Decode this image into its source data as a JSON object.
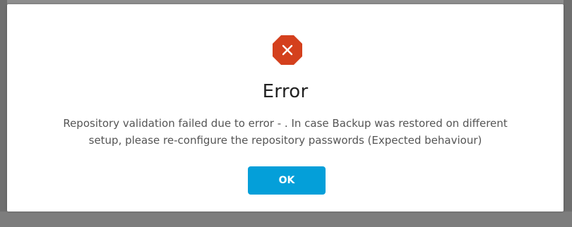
{
  "dialog": {
    "title": "Error",
    "message_line1": "Repository validation failed due to error - . In case Backup was restored on different",
    "message_line2": "setup, please re-configure the repository passwords (Expected behaviour)",
    "ok_label": "OK",
    "icon": "error-x-octagon-icon"
  },
  "colors": {
    "icon_fill": "#d4401d",
    "button": "#049fd9",
    "title_text": "#222222",
    "message_text": "#555555"
  }
}
